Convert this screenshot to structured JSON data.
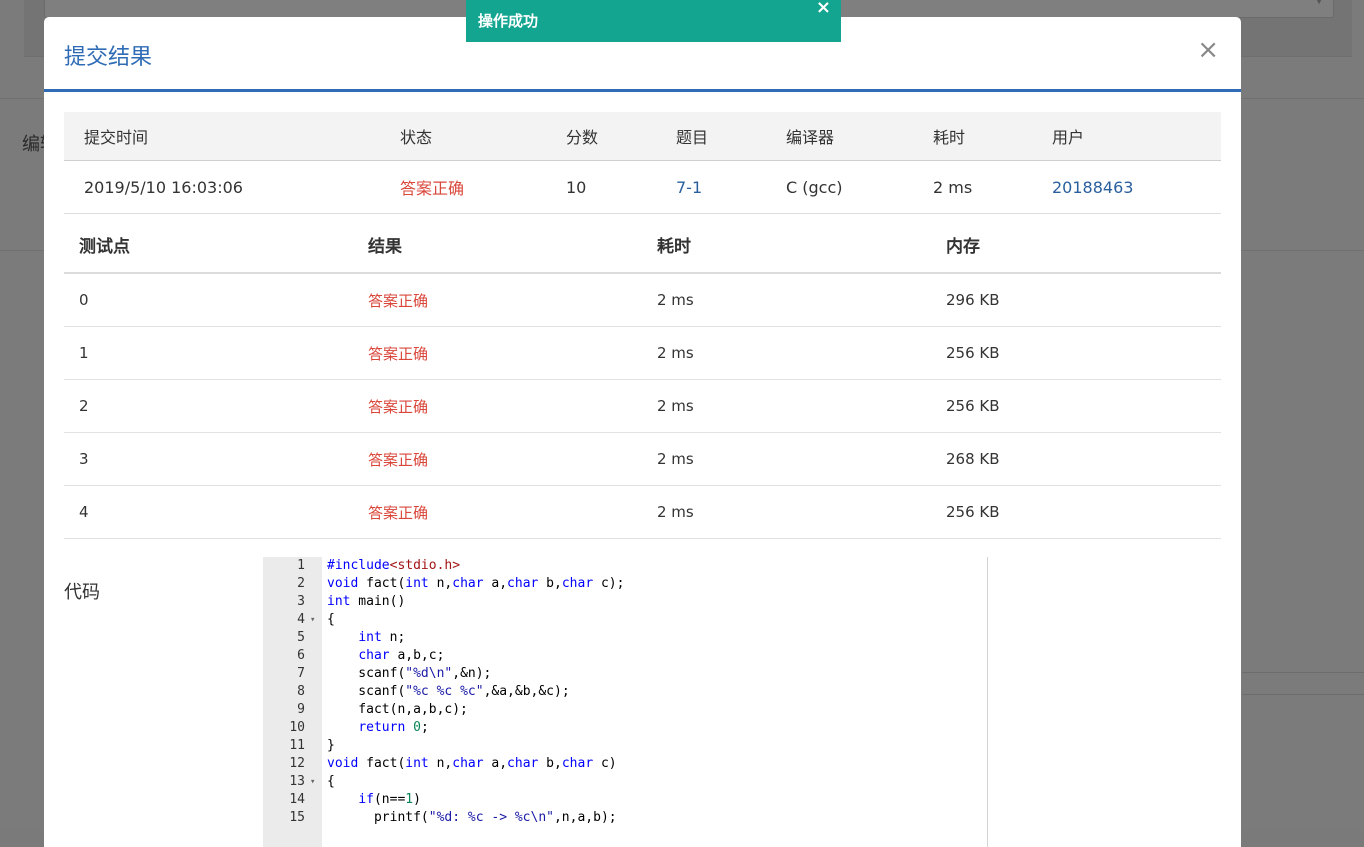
{
  "toast": {
    "message": "操作成功",
    "close": "×"
  },
  "modal": {
    "title": "提交结果",
    "close": "×"
  },
  "background": {
    "label": "编辑",
    "select_text": ""
  },
  "summary": {
    "headers": [
      "提交时间",
      "状态",
      "分数",
      "题目",
      "编译器",
      "耗时",
      "用户"
    ],
    "row": {
      "time": "2019/5/10 16:03:06",
      "status": "答案正确",
      "score": "10",
      "problem": "7-1",
      "compiler": "C (gcc)",
      "elapsed": "2 ms",
      "user": "20188463"
    }
  },
  "cases": {
    "headers": [
      "测试点",
      "结果",
      "耗时",
      "内存"
    ],
    "rows": [
      {
        "id": "0",
        "result": "答案正确",
        "time": "2 ms",
        "memory": "296 KB"
      },
      {
        "id": "1",
        "result": "答案正确",
        "time": "2 ms",
        "memory": "256 KB"
      },
      {
        "id": "2",
        "result": "答案正确",
        "time": "2 ms",
        "memory": "256 KB"
      },
      {
        "id": "3",
        "result": "答案正确",
        "time": "2 ms",
        "memory": "268 KB"
      },
      {
        "id": "4",
        "result": "答案正确",
        "time": "2 ms",
        "memory": "256 KB"
      }
    ]
  },
  "code": {
    "label": "代码",
    "lines": [
      {
        "n": "1",
        "fold": "",
        "text": "#include<stdio.h>"
      },
      {
        "n": "2",
        "fold": "",
        "text": "void fact(int n,char a,char b,char c);"
      },
      {
        "n": "3",
        "fold": "",
        "text": "int main()"
      },
      {
        "n": "4",
        "fold": "▾",
        "text": "{"
      },
      {
        "n": "5",
        "fold": "",
        "text": "    int n;"
      },
      {
        "n": "6",
        "fold": "",
        "text": "    char a,b,c;"
      },
      {
        "n": "7",
        "fold": "",
        "text": "    scanf(\"%d\\n\",&n);"
      },
      {
        "n": "8",
        "fold": "",
        "text": "    scanf(\"%c %c %c\",&a,&b,&c);"
      },
      {
        "n": "9",
        "fold": "",
        "text": "    fact(n,a,b,c);"
      },
      {
        "n": "10",
        "fold": "",
        "text": "    return 0;"
      },
      {
        "n": "11",
        "fold": "",
        "text": "}"
      },
      {
        "n": "12",
        "fold": "",
        "text": "void fact(int n,char a,char b,char c)"
      },
      {
        "n": "13",
        "fold": "▾",
        "text": "{"
      },
      {
        "n": "14",
        "fold": "",
        "text": "    if(n==1)"
      },
      {
        "n": "15",
        "fold": "",
        "text": "      printf(\"%d: %c -> %c\\n\",n,a,b);"
      }
    ]
  }
}
